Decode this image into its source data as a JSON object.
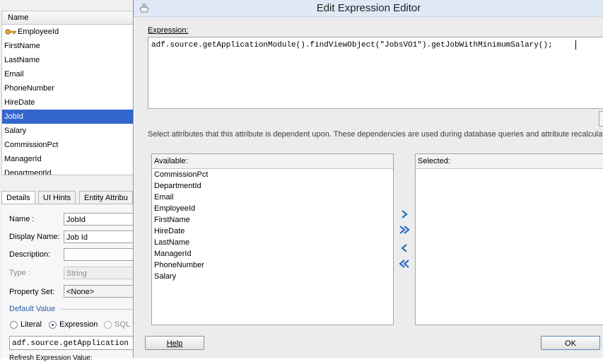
{
  "attributes_table": {
    "header": "Name",
    "rows": [
      "EmployeeId",
      "FirstName",
      "LastName",
      "Email",
      "PhoneNumber",
      "HireDate",
      "JobId",
      "Salary",
      "CommissionPct",
      "ManagerId",
      "DepartmentId"
    ],
    "selected": "JobId"
  },
  "tabs": [
    "Details",
    "UI Hints",
    "Entity Attribu"
  ],
  "details": {
    "name_label": "Name :",
    "name_value": "JobId",
    "display_name_label": "Display Name:",
    "display_name_value": "Job Id",
    "description_label": "Description:",
    "description_value": "",
    "type_label": "Type :",
    "type_value": "String",
    "property_set_label": "Property Set:",
    "property_set_value": "<None>",
    "default_value_section": "Default Value",
    "radio_literal": "Literal",
    "radio_expression": "Expression",
    "radio_sql": "SQL",
    "default_expression_value": "adf.source.getApplication",
    "refresh_label": "Refresh Expression Value:"
  },
  "dialog": {
    "title": "Edit Expression Editor",
    "expression_label": "Expression:",
    "expression_value": "adf.source.getApplicationModule().findViewObject(\"JobsVO1\").getJobWithMinimumSalary();",
    "dependencies_text": "Select attributes that this attribute is dependent upon. These dependencies are used during database queries and attribute recalculati",
    "available_label": "Available:",
    "available_items": [
      "CommissionPct",
      "DepartmentId",
      "Email",
      "EmployeeId",
      "FirstName",
      "HireDate",
      "LastName",
      "ManagerId",
      "PhoneNumber",
      "Salary"
    ],
    "selected_label": "Selected:",
    "selected_items": [],
    "help_button": "Help",
    "ok_button": "OK"
  },
  "colors": {
    "selection": "#3366cc",
    "shuttle_arrow": "#2e6fc4",
    "titlebar": "#dfe9f5"
  },
  "icons": [
    "key-icon",
    "app-icon",
    "move-right-icon",
    "move-all-right-icon",
    "move-left-icon",
    "move-all-left-icon"
  ]
}
